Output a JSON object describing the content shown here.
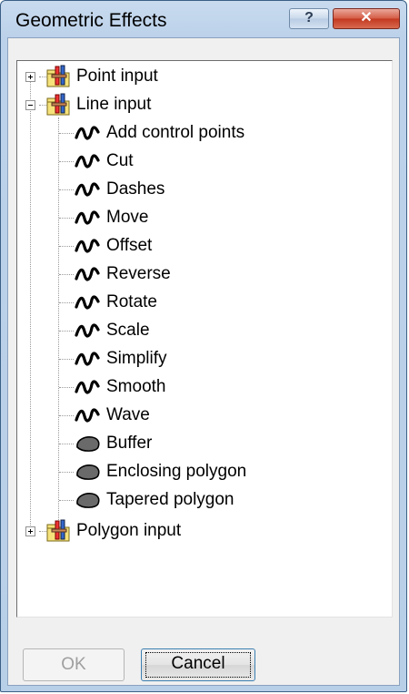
{
  "window": {
    "title": "Geometric Effects",
    "help_label": "?",
    "close_label": "✕"
  },
  "tree": {
    "groups": [
      {
        "label": "Point input",
        "expanded": false
      },
      {
        "label": "Line input",
        "expanded": true,
        "children": [
          "Add control points",
          "Cut",
          "Dashes",
          "Move",
          "Offset",
          "Reverse",
          "Rotate",
          "Scale",
          "Simplify",
          "Smooth",
          "Wave",
          "Buffer",
          "Enclosing polygon",
          "Tapered polygon"
        ]
      },
      {
        "label": "Polygon input",
        "expanded": false
      }
    ]
  },
  "buttons": {
    "ok_label": "OK",
    "cancel_label": "Cancel"
  },
  "icons": {
    "group": "folder-tool-icon",
    "line_effect": "wave-icon",
    "polygon_effect": "polygon-blob-icon"
  }
}
